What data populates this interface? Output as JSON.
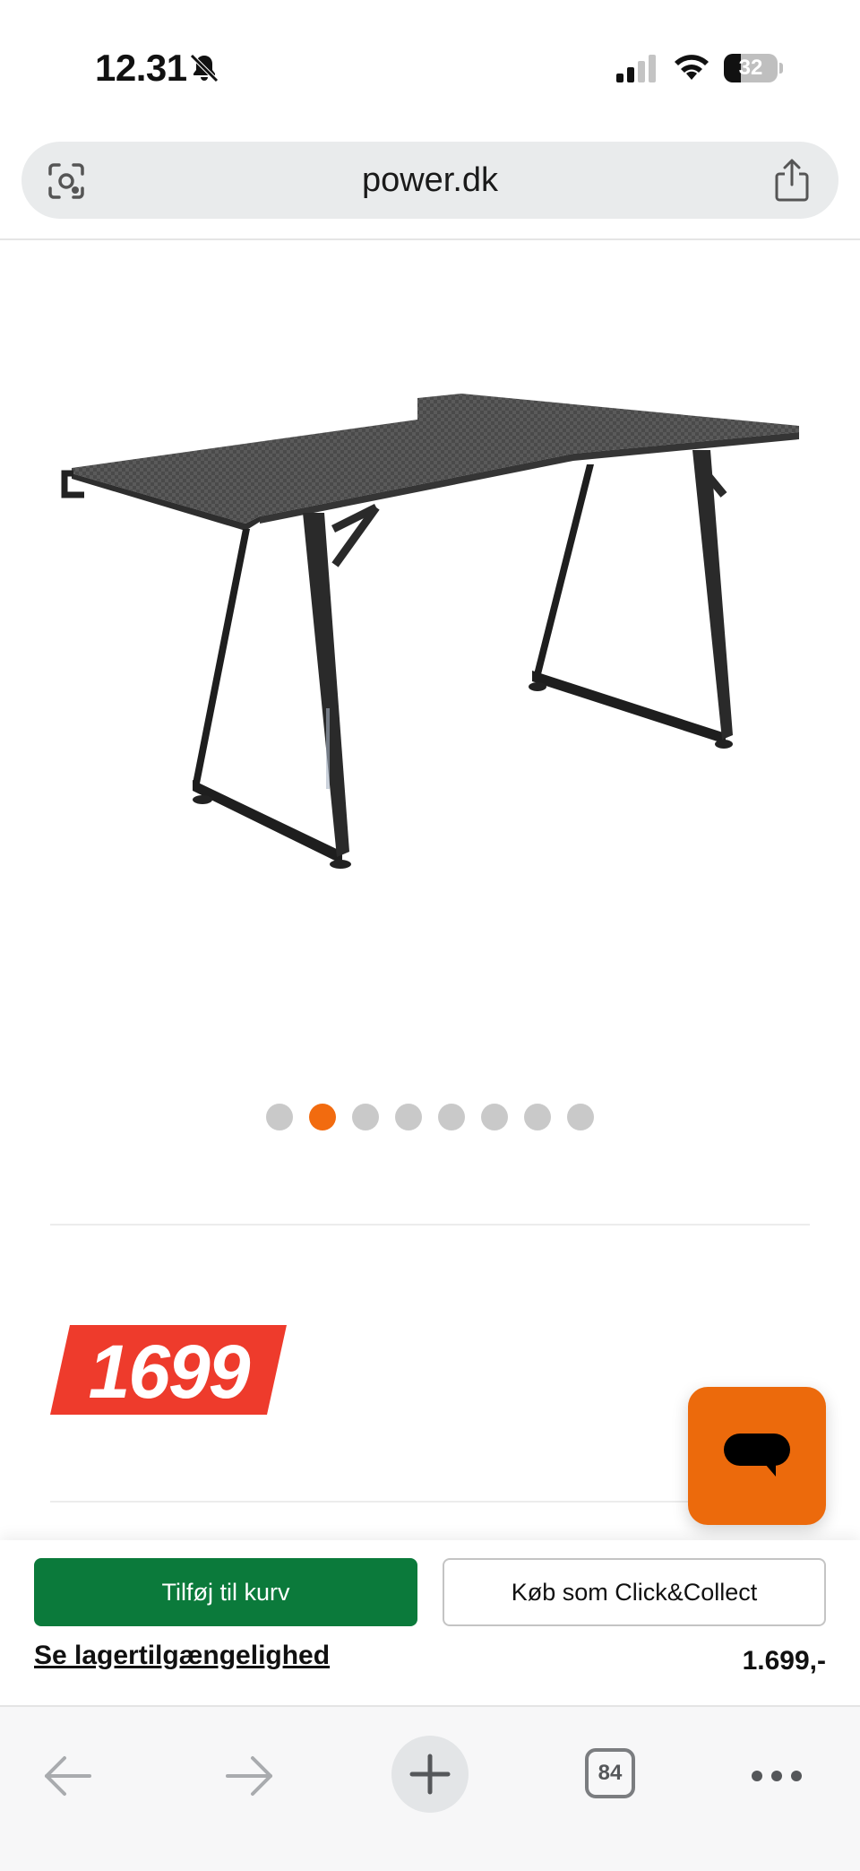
{
  "status_bar": {
    "time": "12.31",
    "battery": "32",
    "battery_level": 0.32,
    "icons": [
      "bell-off-icon",
      "signal-icon",
      "wifi-icon",
      "battery-icon"
    ]
  },
  "browser": {
    "url": "power.dk",
    "left_icon": "visual-search-icon",
    "right_icon": "share-icon"
  },
  "product": {
    "image_description_icon": "gaming-desk-image",
    "carousel": {
      "total": 8,
      "active_index": 1
    },
    "price_tag": "1699",
    "price_tag_color": "#ee3b2c"
  },
  "chat": {
    "icon": "chat-bubble-icon",
    "color": "#ec6a0c"
  },
  "purchase": {
    "add_to_cart": "Tilføj til kurv",
    "click_collect": "Køb som Click&Collect",
    "stock_link": "Se lagertilgængelighed",
    "price": "1.699,-",
    "primary_color": "#0b7a3b"
  },
  "toolbar": {
    "tab_count": "84",
    "icons": [
      "back-arrow-icon",
      "forward-arrow-icon",
      "new-tab-plus-icon",
      "tabs-icon",
      "more-icon"
    ]
  }
}
